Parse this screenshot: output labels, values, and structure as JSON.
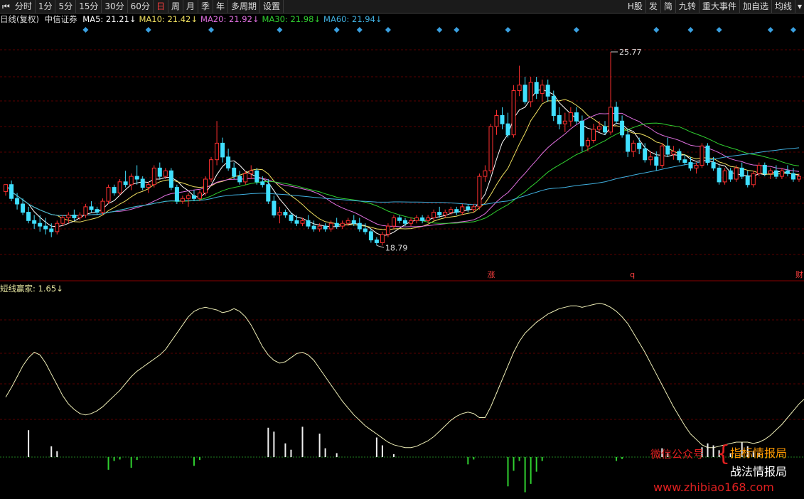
{
  "toolbar": {
    "left_items": [
      "分时",
      "1分",
      "5分",
      "15分",
      "30分",
      "60分",
      "日",
      "周",
      "月",
      "季",
      "年",
      "多周期",
      "设置"
    ],
    "active": "日",
    "right_items": [
      "H股",
      "发",
      "简",
      "九转",
      "重大事件",
      "加自选",
      "均线"
    ]
  },
  "legend": {
    "prefix": "日线(复权)",
    "stock": "中信证券",
    "items": [
      {
        "label": "MA5: 21.21↓",
        "color": "#ffffff"
      },
      {
        "label": "MA10: 21.42↓",
        "color": "#f0e060"
      },
      {
        "label": "MA20: 21.92↓",
        "color": "#e070e0"
      },
      {
        "label": "MA30: 21.98↓",
        "color": "#30d030"
      },
      {
        "label": "MA60: 21.94↓",
        "color": "#40b0e0"
      }
    ]
  },
  "indicator_legend": "短线赢家: 1.65↓",
  "watermark": {
    "line1": "微信公众号",
    "name1": "指标情报局",
    "name2": "战法情报局",
    "url": "www.zhibiao168.com"
  },
  "chart_data": {
    "type": "candlestick",
    "price_range": [
      17.6,
      26.7
    ],
    "annotations": {
      "high_label": "25.77",
      "low_label": "18.79",
      "marker_labels": [
        "涨",
        "q",
        "财"
      ]
    },
    "candles": [
      [
        20.75,
        21.0,
        20.6,
        21.0
      ],
      [
        21.0,
        21.15,
        20.4,
        20.5
      ],
      [
        20.5,
        20.7,
        20.1,
        20.3
      ],
      [
        20.3,
        20.5,
        19.9,
        20.0
      ],
      [
        20.0,
        20.2,
        19.6,
        19.7
      ],
      [
        19.7,
        19.9,
        19.4,
        19.6
      ],
      [
        19.6,
        19.9,
        19.3,
        19.5
      ],
      [
        19.5,
        19.8,
        19.2,
        19.4
      ],
      [
        19.4,
        19.6,
        19.1,
        19.3
      ],
      [
        19.3,
        19.7,
        19.2,
        19.6
      ],
      [
        19.6,
        19.9,
        19.5,
        19.8
      ],
      [
        19.8,
        20.0,
        19.6,
        19.9
      ],
      [
        19.9,
        20.1,
        19.7,
        19.8
      ],
      [
        19.8,
        20.0,
        19.7,
        19.9
      ],
      [
        19.9,
        20.3,
        19.8,
        20.2
      ],
      [
        20.2,
        20.4,
        20.0,
        20.1
      ],
      [
        20.1,
        20.2,
        19.9,
        20.0
      ],
      [
        20.0,
        20.5,
        19.9,
        20.4
      ],
      [
        20.4,
        21.0,
        20.3,
        20.9
      ],
      [
        20.9,
        21.0,
        20.6,
        20.7
      ],
      [
        20.7,
        21.2,
        20.6,
        21.1
      ],
      [
        21.1,
        21.5,
        20.9,
        21.0
      ],
      [
        21.0,
        21.4,
        20.8,
        21.3
      ],
      [
        21.3,
        21.7,
        21.0,
        21.2
      ],
      [
        21.2,
        21.3,
        20.8,
        20.9
      ],
      [
        20.9,
        21.1,
        20.7,
        21.0
      ],
      [
        21.0,
        21.7,
        20.9,
        21.6
      ],
      [
        21.6,
        21.8,
        21.2,
        21.3
      ],
      [
        21.3,
        21.6,
        21.2,
        21.5
      ],
      [
        21.5,
        21.6,
        20.8,
        20.9
      ],
      [
        20.9,
        21.0,
        20.3,
        20.4
      ],
      [
        20.4,
        20.6,
        20.3,
        20.5
      ],
      [
        20.5,
        20.7,
        20.2,
        20.6
      ],
      [
        20.6,
        20.8,
        20.4,
        20.5
      ],
      [
        20.5,
        20.8,
        20.4,
        20.7
      ],
      [
        20.7,
        21.3,
        20.6,
        21.2
      ],
      [
        21.2,
        22.0,
        21.1,
        21.9
      ],
      [
        21.9,
        23.3,
        21.7,
        22.5
      ],
      [
        22.5,
        22.7,
        21.8,
        22.0
      ],
      [
        22.0,
        22.3,
        21.5,
        21.6
      ],
      [
        21.6,
        21.8,
        21.2,
        21.3
      ],
      [
        21.3,
        21.5,
        21.0,
        21.1
      ],
      [
        21.1,
        21.5,
        21.0,
        21.4
      ],
      [
        21.4,
        21.7,
        21.2,
        21.5
      ],
      [
        21.5,
        21.6,
        21.0,
        21.1
      ],
      [
        21.1,
        21.3,
        20.9,
        21.0
      ],
      [
        21.0,
        21.2,
        20.3,
        20.4
      ],
      [
        20.4,
        20.6,
        19.8,
        19.9
      ],
      [
        19.9,
        20.2,
        19.6,
        20.0
      ],
      [
        20.0,
        20.1,
        19.8,
        19.9
      ],
      [
        19.9,
        20.0,
        19.6,
        19.7
      ],
      [
        19.7,
        19.9,
        19.5,
        19.6
      ],
      [
        19.6,
        19.8,
        19.5,
        19.7
      ],
      [
        19.7,
        19.9,
        19.4,
        19.5
      ],
      [
        19.5,
        19.7,
        19.3,
        19.4
      ],
      [
        19.4,
        19.6,
        19.3,
        19.5
      ],
      [
        19.5,
        19.6,
        19.3,
        19.4
      ],
      [
        19.4,
        19.7,
        19.3,
        19.6
      ],
      [
        19.6,
        19.8,
        19.4,
        19.5
      ],
      [
        19.5,
        19.7,
        19.4,
        19.6
      ],
      [
        19.6,
        19.8,
        19.5,
        19.7
      ],
      [
        19.7,
        19.9,
        19.5,
        19.6
      ],
      [
        19.6,
        19.8,
        19.3,
        19.4
      ],
      [
        19.4,
        19.6,
        19.2,
        19.3
      ],
      [
        19.3,
        19.4,
        18.9,
        19.0
      ],
      [
        19.0,
        19.1,
        18.8,
        18.9
      ],
      [
        18.9,
        19.3,
        18.8,
        19.2
      ],
      [
        19.2,
        19.6,
        19.1,
        19.5
      ],
      [
        19.5,
        19.9,
        19.4,
        19.8
      ],
      [
        19.8,
        19.9,
        19.6,
        19.7
      ],
      [
        19.7,
        19.8,
        19.5,
        19.6
      ],
      [
        19.6,
        19.8,
        19.5,
        19.7
      ],
      [
        19.7,
        19.9,
        19.6,
        19.8
      ],
      [
        19.8,
        19.9,
        19.6,
        19.7
      ],
      [
        19.7,
        19.9,
        19.6,
        19.8
      ],
      [
        19.8,
        20.1,
        19.7,
        20.0
      ],
      [
        20.0,
        20.2,
        19.8,
        19.9
      ],
      [
        19.9,
        20.1,
        19.8,
        20.0
      ],
      [
        20.0,
        20.2,
        19.9,
        20.1
      ],
      [
        20.1,
        20.2,
        19.9,
        20.0
      ],
      [
        20.0,
        20.3,
        19.9,
        20.2
      ],
      [
        20.2,
        20.3,
        20.0,
        20.1
      ],
      [
        20.1,
        20.3,
        20.0,
        20.2
      ],
      [
        20.2,
        21.4,
        20.1,
        21.3
      ],
      [
        21.3,
        21.7,
        21.1,
        21.5
      ],
      [
        21.5,
        23.2,
        21.4,
        23.1
      ],
      [
        23.1,
        23.7,
        22.8,
        23.5
      ],
      [
        23.5,
        23.8,
        23.0,
        23.2
      ],
      [
        23.2,
        23.6,
        22.7,
        22.8
      ],
      [
        22.8,
        24.6,
        22.7,
        24.4
      ],
      [
        24.4,
        25.3,
        24.2,
        24.6
      ],
      [
        24.6,
        24.9,
        23.9,
        24.0
      ],
      [
        24.0,
        24.9,
        23.8,
        24.7
      ],
      [
        24.7,
        24.9,
        24.1,
        24.3
      ],
      [
        24.3,
        24.8,
        24.0,
        24.6
      ],
      [
        24.6,
        24.8,
        24.0,
        24.2
      ],
      [
        24.2,
        24.4,
        23.3,
        23.5
      ],
      [
        23.5,
        23.8,
        23.0,
        23.2
      ],
      [
        23.2,
        23.6,
        22.9,
        23.3
      ],
      [
        23.3,
        23.8,
        23.1,
        23.6
      ],
      [
        23.6,
        23.8,
        23.2,
        23.3
      ],
      [
        23.3,
        23.5,
        22.2,
        22.4
      ],
      [
        22.4,
        22.7,
        22.2,
        22.6
      ],
      [
        22.6,
        23.2,
        22.5,
        23.0
      ],
      [
        23.0,
        23.3,
        22.9,
        23.1
      ],
      [
        23.1,
        23.3,
        22.8,
        22.9
      ],
      [
        22.9,
        25.8,
        22.8,
        23.8
      ],
      [
        23.8,
        24.0,
        23.2,
        23.3
      ],
      [
        23.3,
        23.5,
        22.7,
        22.8
      ],
      [
        22.8,
        23.0,
        22.0,
        22.2
      ],
      [
        22.2,
        22.6,
        22.0,
        22.5
      ],
      [
        22.5,
        22.7,
        22.1,
        22.3
      ],
      [
        22.3,
        22.5,
        21.8,
        21.9
      ],
      [
        21.9,
        22.2,
        21.7,
        22.0
      ],
      [
        22.0,
        22.2,
        21.5,
        21.7
      ],
      [
        21.7,
        22.5,
        21.6,
        22.4
      ],
      [
        22.4,
        22.7,
        22.0,
        22.1
      ],
      [
        22.1,
        22.4,
        21.9,
        22.2
      ],
      [
        22.2,
        22.3,
        21.8,
        21.9
      ],
      [
        21.9,
        22.1,
        21.7,
        21.8
      ],
      [
        21.8,
        22.0,
        21.5,
        21.6
      ],
      [
        21.6,
        21.8,
        21.4,
        21.7
      ],
      [
        21.7,
        22.5,
        21.6,
        22.4
      ],
      [
        22.4,
        22.5,
        21.7,
        21.8
      ],
      [
        21.8,
        22.0,
        21.5,
        21.6
      ],
      [
        21.6,
        21.7,
        21.0,
        21.1
      ],
      [
        21.1,
        21.6,
        21.0,
        21.5
      ],
      [
        21.5,
        21.6,
        21.1,
        21.2
      ],
      [
        21.2,
        21.7,
        21.1,
        21.6
      ],
      [
        21.6,
        21.8,
        21.2,
        21.3
      ],
      [
        21.3,
        21.5,
        20.9,
        21.0
      ],
      [
        21.0,
        21.5,
        20.9,
        21.4
      ],
      [
        21.4,
        21.8,
        21.3,
        21.7
      ],
      [
        21.7,
        21.8,
        21.3,
        21.4
      ],
      [
        21.4,
        21.6,
        21.2,
        21.5
      ],
      [
        21.5,
        21.7,
        21.2,
        21.3
      ],
      [
        21.3,
        21.6,
        21.2,
        21.5
      ],
      [
        21.5,
        21.7,
        21.3,
        21.4
      ],
      [
        21.4,
        21.6,
        21.1,
        21.2
      ],
      [
        21.2,
        21.4,
        21.1,
        21.3
      ]
    ],
    "ma_periods": [
      5,
      10,
      20,
      30,
      60
    ],
    "ma_colors": [
      "#ffffff",
      "#f0e060",
      "#e070e0",
      "#30d030",
      "#40b0e0"
    ],
    "indicator": {
      "name": "短线赢家",
      "value": "1.65",
      "line": [
        45,
        52,
        60,
        68,
        74,
        78,
        76,
        70,
        62,
        54,
        46,
        40,
        36,
        33,
        32,
        33,
        35,
        38,
        42,
        46,
        50,
        55,
        60,
        64,
        67,
        70,
        73,
        76,
        80,
        86,
        92,
        98,
        104,
        108,
        110,
        111,
        110,
        109,
        107,
        108,
        110,
        108,
        104,
        98,
        90,
        82,
        76,
        72,
        70,
        71,
        74,
        77,
        78,
        76,
        72,
        66,
        60,
        54,
        48,
        42,
        37,
        32,
        28,
        24,
        21,
        18,
        15,
        12,
        10,
        9,
        8,
        8,
        9,
        11,
        13,
        16,
        20,
        24,
        28,
        31,
        33,
        34,
        33,
        30,
        30,
        38,
        48,
        58,
        68,
        78,
        86,
        92,
        96,
        100,
        103,
        106,
        108,
        110,
        111,
        112,
        112,
        111,
        112,
        113,
        114,
        113,
        111,
        108,
        104,
        99,
        92,
        85,
        78,
        70,
        62,
        54,
        46,
        38,
        31,
        24,
        18,
        14,
        10,
        8,
        8,
        9,
        10,
        11,
        12,
        12,
        12,
        11,
        12,
        14,
        17,
        21,
        25,
        30,
        35,
        40,
        44,
        46,
        48,
        52,
        58,
        63,
        68
      ],
      "range": [
        0,
        120
      ],
      "bars": [
        0,
        0,
        0,
        0,
        55,
        0,
        0,
        0,
        22,
        12,
        0,
        0,
        0,
        0,
        0,
        0,
        0,
        0,
        -26,
        -8,
        -5,
        0,
        -22,
        -6,
        0,
        0,
        0,
        0,
        0,
        0,
        0,
        0,
        0,
        -18,
        -6,
        0,
        0,
        0,
        0,
        0,
        0,
        0,
        0,
        0,
        0,
        0,
        60,
        52,
        0,
        28,
        15,
        0,
        62,
        0,
        0,
        48,
        18,
        0,
        8,
        0,
        0,
        0,
        0,
        0,
        0,
        40,
        24,
        0,
        6,
        0,
        0,
        0,
        0,
        0,
        0,
        0,
        0,
        0,
        0,
        0,
        0,
        -15,
        -5,
        0,
        0,
        0,
        0,
        0,
        -60,
        -28,
        -8,
        -72,
        -55,
        -30,
        -8,
        0,
        0,
        0,
        0,
        0,
        0,
        0,
        0,
        0,
        0,
        0,
        0,
        -8,
        -4,
        0,
        0,
        0,
        0,
        0,
        0,
        18,
        8,
        0,
        0,
        0,
        0,
        0,
        20,
        28,
        24,
        14,
        0,
        8,
        0,
        30,
        22,
        12,
        8,
        0,
        0,
        0,
        0,
        0,
        0,
        0,
        0,
        0,
        0,
        0,
        0,
        0,
        0,
        0,
        0,
        0,
        0,
        0
      ],
      "bar_range": [
        -80,
        80
      ]
    },
    "signal_markers": [
      14,
      25,
      36,
      48,
      58,
      62,
      67,
      76,
      79,
      88,
      100,
      114,
      120,
      125,
      134,
      138,
      142,
      151,
      157,
      164,
      173,
      185,
      197,
      202
    ]
  }
}
